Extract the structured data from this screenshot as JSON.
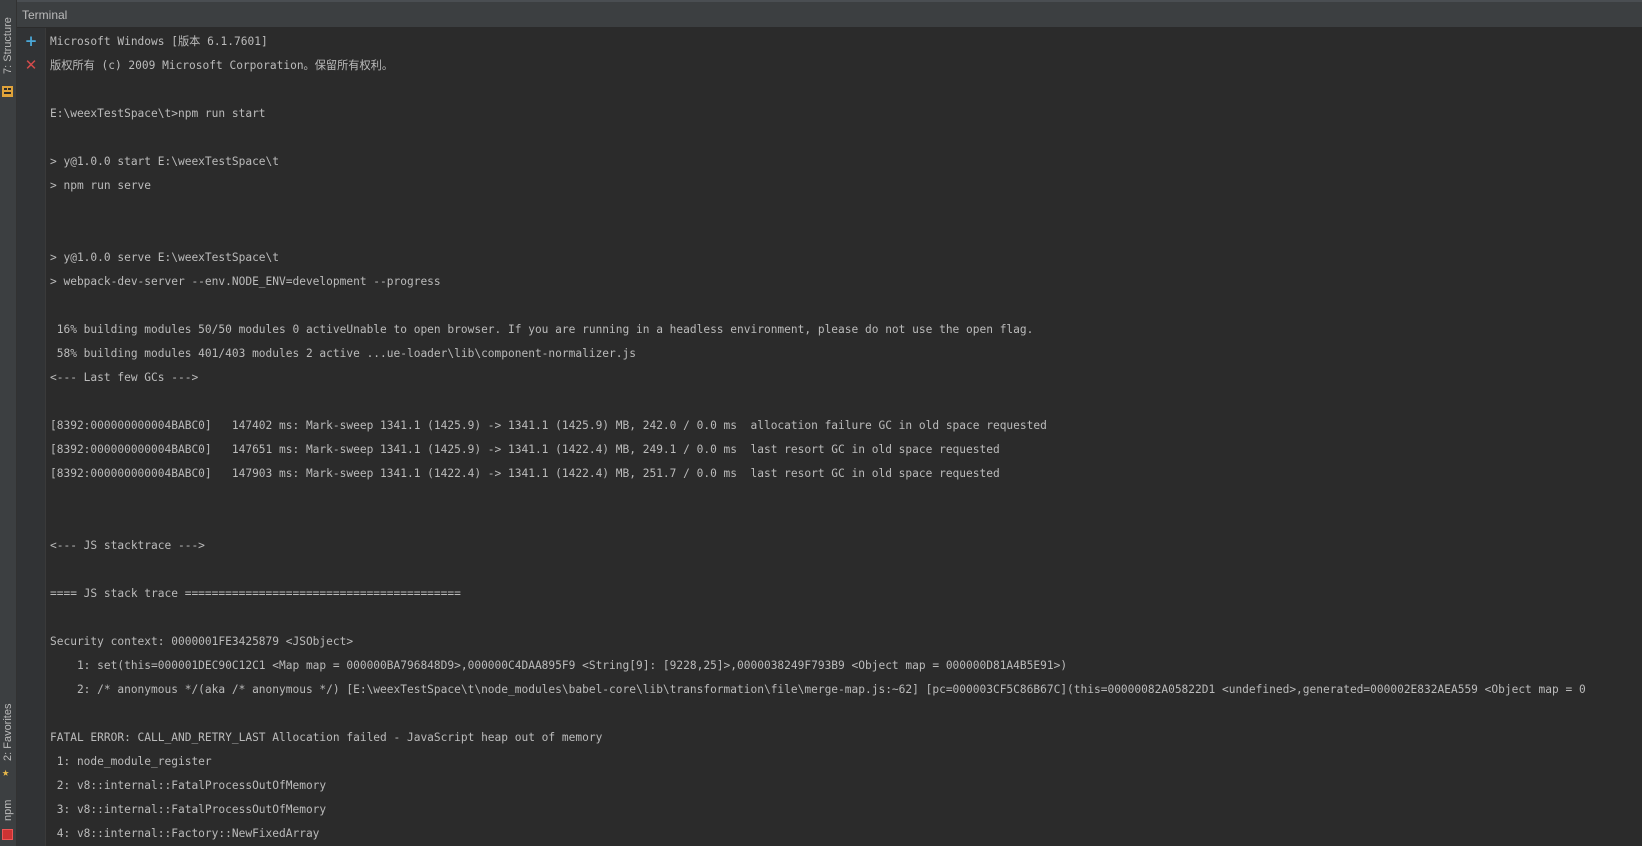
{
  "window": {
    "title": "Terminal"
  },
  "side_tabs": {
    "structure": "7: Structure",
    "favorites": "2: Favorites",
    "npm": "npm"
  },
  "toolbar": {
    "add_label": "+",
    "close_label": "✕"
  },
  "terminal": {
    "lines": [
      "Microsoft Windows [版本 6.1.7601]",
      "版权所有 (c) 2009 Microsoft Corporation。保留所有权利。",
      "",
      "E:\\weexTestSpace\\t>npm run start",
      "",
      "> y@1.0.0 start E:\\weexTestSpace\\t",
      "> npm run serve",
      "",
      "",
      "> y@1.0.0 serve E:\\weexTestSpace\\t",
      "> webpack-dev-server --env.NODE_ENV=development --progress",
      "",
      " 16% building modules 50/50 modules 0 activeUnable to open browser. If you are running in a headless environment, please do not use the open flag.",
      " 58% building modules 401/403 modules 2 active ...ue-loader\\lib\\component-normalizer.js",
      "<--- Last few GCs --->",
      "",
      "[8392:000000000004BABC0]   147402 ms: Mark-sweep 1341.1 (1425.9) -> 1341.1 (1425.9) MB, 242.0 / 0.0 ms  allocation failure GC in old space requested",
      "[8392:000000000004BABC0]   147651 ms: Mark-sweep 1341.1 (1425.9) -> 1341.1 (1422.4) MB, 249.1 / 0.0 ms  last resort GC in old space requested",
      "[8392:000000000004BABC0]   147903 ms: Mark-sweep 1341.1 (1422.4) -> 1341.1 (1422.4) MB, 251.7 / 0.0 ms  last resort GC in old space requested",
      "",
      "",
      "<--- JS stacktrace --->",
      "",
      "==== JS stack trace =========================================",
      "",
      "Security context: 0000001FE3425879 <JSObject>",
      "    1: set(this=000001DEC90C12C1 <Map map = 000000BA796848D9>,000000C4DAA895F9 <String[9]: [9228,25]>,0000038249F793B9 <Object map = 000000D81A4B5E91>)",
      "    2: /* anonymous */(aka /* anonymous */) [E:\\weexTestSpace\\t\\node_modules\\babel-core\\lib\\transformation\\file\\merge-map.js:~62] [pc=000003CF5C86B67C](this=00000082A05822D1 <undefined>,generated=000002E832AEA559 <Object map = 0",
      "",
      "FATAL ERROR: CALL_AND_RETRY_LAST Allocation failed - JavaScript heap out of memory",
      " 1: node_module_register",
      " 2: v8::internal::FatalProcessOutOfMemory",
      " 3: v8::internal::FatalProcessOutOfMemory",
      " 4: v8::internal::Factory::NewFixedArray"
    ]
  }
}
